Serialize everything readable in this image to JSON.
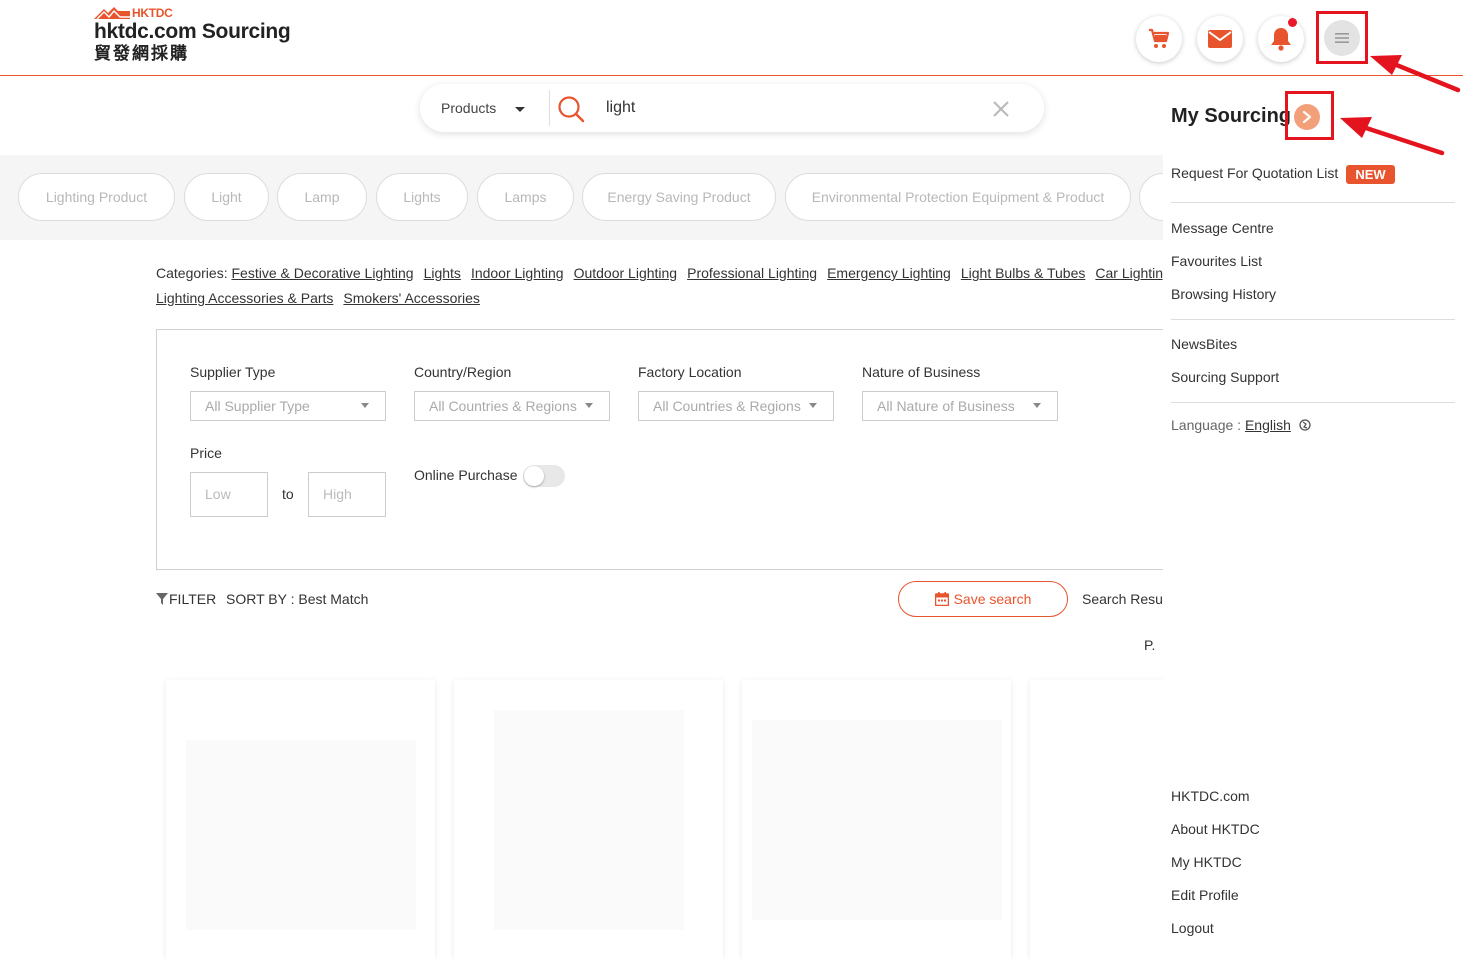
{
  "header": {
    "logo_brand": "HKTDC",
    "logo_title": "hktdc.com Sourcing",
    "logo_chinese": "貿發網採購",
    "icons": [
      "cart-icon",
      "mail-icon",
      "bell-icon",
      "menu-icon"
    ]
  },
  "search": {
    "type_label": "Products",
    "query": "light"
  },
  "chips": [
    "Lighting Product",
    "Light",
    "Lamp",
    "Lights",
    "Lamps",
    "Energy Saving Product",
    "Environmental Protection Equipment & Product"
  ],
  "categories": {
    "label": "Categories:",
    "row1": [
      "Festive & Decorative Lighting",
      "Lights",
      "Indoor Lighting",
      "Outdoor Lighting",
      "Professional Lighting",
      "Emergency Lighting",
      "Light Bulbs & Tubes",
      "Car Lighting"
    ],
    "row2": [
      "Lighting Accessories & Parts",
      "Smokers' Accessories"
    ]
  },
  "filters": {
    "supplier_type": {
      "label": "Supplier Type",
      "value": "All Supplier Type"
    },
    "country_region": {
      "label": "Country/Region",
      "value": "All Countries & Regions"
    },
    "factory_location": {
      "label": "Factory Location",
      "value": "All Countries & Regions"
    },
    "nature_of_business": {
      "label": "Nature of Business",
      "value": "All Nature of Business"
    },
    "price": {
      "label": "Price",
      "low_placeholder": "Low",
      "to": "to",
      "high_placeholder": "High"
    },
    "online_purchase": {
      "label": "Online Purchase",
      "enabled": false
    }
  },
  "results_bar": {
    "filter_label": "FILTER",
    "sort_label": "SORT BY : Best Match",
    "save_search": "Save search",
    "search_result": "Search Resul",
    "page_label": "P."
  },
  "side_panel": {
    "title": "My Sourcing",
    "rfq": "Request For Quotation List",
    "new_badge": "NEW",
    "group1": [
      "Message Centre",
      "Favourites List",
      "Browsing History"
    ],
    "group2": [
      "NewsBites",
      "Sourcing Support"
    ],
    "language_label": "Language : ",
    "language_value": "English",
    "footer": [
      "HKTDC.com",
      "About HKTDC",
      "My HKTDC",
      "Edit Profile",
      "Logout"
    ]
  },
  "colors": {
    "brand": "#e8542d",
    "annotation": "#e4141e",
    "notification": "#e8192c"
  }
}
